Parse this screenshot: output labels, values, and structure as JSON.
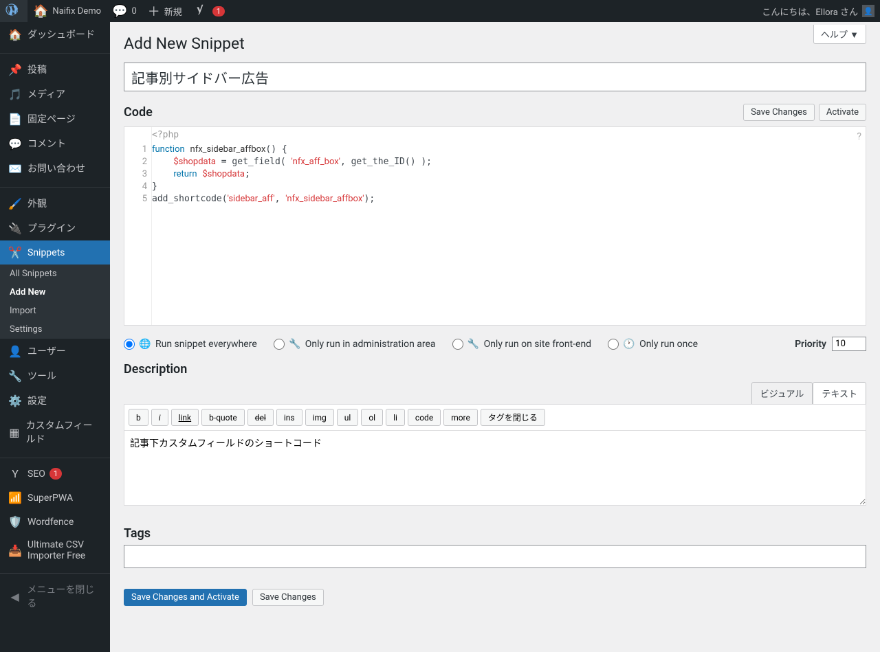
{
  "adminbar": {
    "site_name": "Naifix Demo",
    "comments": "0",
    "new_label": "新規",
    "yoast_badge": "1",
    "greeting": "こんにちは、Ellora さん"
  },
  "help_label": "ヘルプ ▼",
  "sidebar": {
    "dashboard": "ダッシュボード",
    "posts": "投稿",
    "media": "メディア",
    "pages": "固定ページ",
    "comments": "コメント",
    "contact": "お問い合わせ",
    "appearance": "外観",
    "plugins": "プラグイン",
    "snippets": "Snippets",
    "sub": {
      "all": "All Snippets",
      "add": "Add New",
      "import": "Import",
      "settings": "Settings"
    },
    "users": "ユーザー",
    "tools": "ツール",
    "settings": "設定",
    "customfields": "カスタムフィールド",
    "seo": "SEO",
    "seo_badge": "1",
    "superpwa": "SuperPWA",
    "wordfence": "Wordfence",
    "csv": "Ultimate CSV Importer Free",
    "collapse": "メニューを閉じる"
  },
  "page": {
    "heading": "Add New Snippet",
    "title_value": "記事別サイドバー広告",
    "code_label": "Code",
    "save_changes": "Save Changes",
    "activate": "Activate",
    "phptag": "<?php",
    "code_lines": [
      "1",
      "2",
      "3",
      "4",
      "5"
    ],
    "scope": {
      "everywhere": "Run snippet everywhere",
      "admin": "Only run in administration area",
      "front": "Only run on site front-end",
      "once": "Only run once"
    },
    "priority_label": "Priority",
    "priority_value": "10",
    "description_label": "Description",
    "tabs": {
      "visual": "ビジュアル",
      "text": "テキスト"
    },
    "edbtn": {
      "b": "b",
      "i": "i",
      "link": "link",
      "bquote": "b-quote",
      "del": "del",
      "ins": "ins",
      "img": "img",
      "ul": "ul",
      "ol": "ol",
      "li": "li",
      "code": "code",
      "more": "more",
      "close": "タグを閉じる"
    },
    "desc_value": "記事下カスタムフィールドのショートコード",
    "tags_label": "Tags",
    "save_activate": "Save Changes and Activate"
  }
}
